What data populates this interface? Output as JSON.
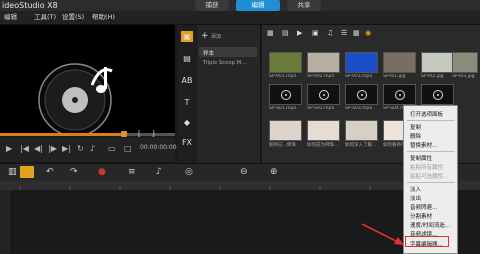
{
  "app": {
    "title": "ideoStudio X8"
  },
  "menu": {
    "items": [
      "编辑",
      "工具(T)",
      "设置(S)",
      "帮助(H)"
    ]
  },
  "modes": {
    "capture": "捕获",
    "edit": "编辑",
    "share": "共享"
  },
  "library": {
    "add_label": "添加",
    "folders": [
      "样本",
      "Triple Scoop M..."
    ],
    "thumbs": [
      "SP-V01.mp4",
      "SP-V02.mp4",
      "SP-V03.mp4",
      "SP-I01.jpg",
      "SP-I02.jpg",
      "SP-I03.jpg",
      "SP-S01.mpa",
      "SP-S02.mpa",
      "SP-S03.mpa",
      "SP-S04.mpa",
      "SP-S05.mpa",
      "SP-S06.mpa",
      "期待已...佛珠",
      "如何成为佛珠...",
      "如何深入了解...",
      "如何看待不完...",
      "如何培养...",
      "..."
    ]
  },
  "preview": {
    "timecode": "00:00:00:00"
  },
  "context_menu": {
    "items": [
      "打开选项面板",
      "复制",
      "删除",
      "替换素材...",
      "复制属性",
      "粘贴所有属性",
      "粘贴可选属性...",
      "淡入",
      "淡出",
      "音频閃避...",
      "分割素材",
      "速度/时间流逝...",
      "音频滤镜...",
      "字幕编辑器..."
    ],
    "disabled": [
      5,
      6
    ]
  },
  "colors": {
    "accent": "#1e8fd6",
    "highlight": "#e03030",
    "scrub": "#e07a1a"
  }
}
